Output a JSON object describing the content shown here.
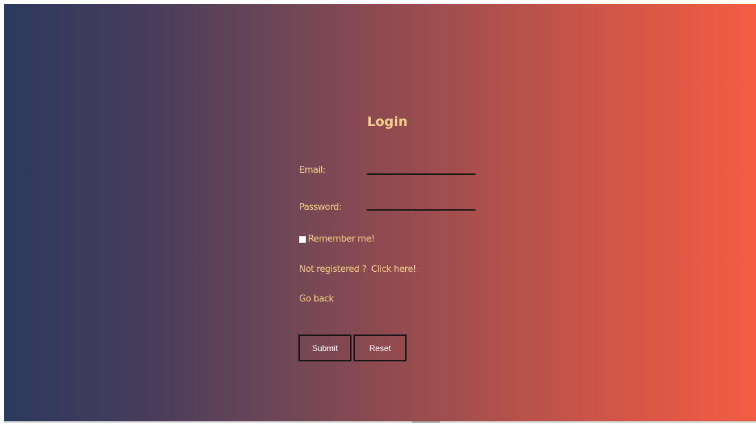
{
  "login": {
    "title": "Login",
    "email_label": "Email:",
    "email_value": "",
    "password_label": "Password:",
    "password_value": "",
    "remember_label": "Remember me!",
    "remember_checked": false,
    "not_registered_text": "Not registered ?",
    "register_link": "Click here!",
    "go_back_link": "Go back",
    "submit_label": "Submit",
    "reset_label": "Reset"
  },
  "colors": {
    "gradient_start": "#2c3a5e",
    "gradient_end": "#f45c43",
    "text": "#f3cf8a",
    "button_text": "#ffffff",
    "border": "#141414"
  }
}
